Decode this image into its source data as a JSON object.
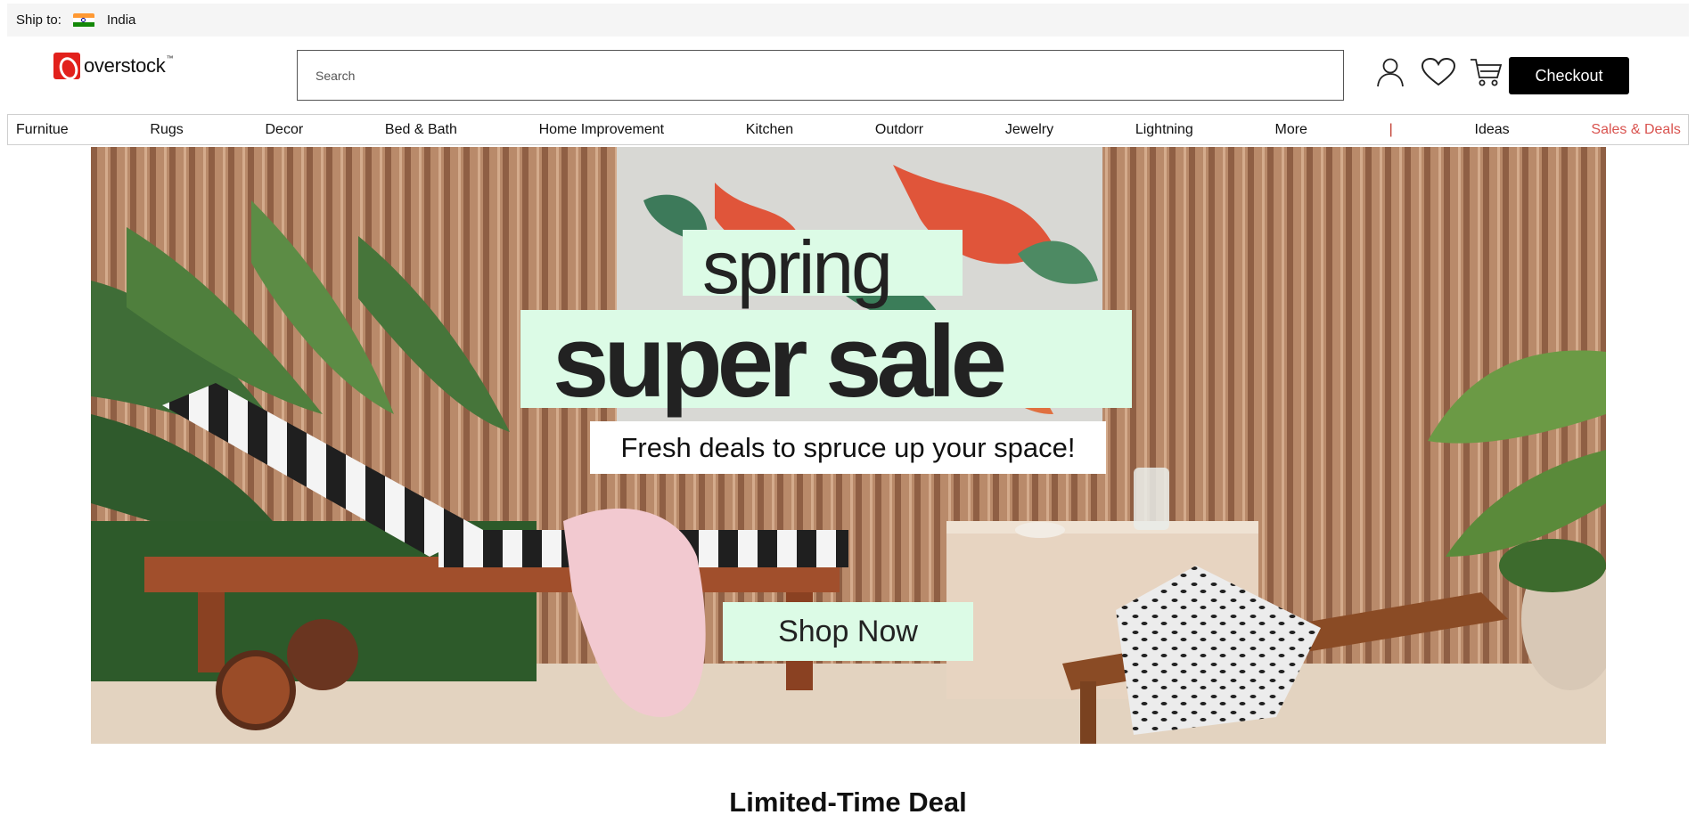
{
  "topbar": {
    "ship_label": "Ship to:",
    "country": "India",
    "flag_icon": "india-flag-icon"
  },
  "header": {
    "logo_text": "overstock",
    "logo_tm": "™",
    "search_placeholder": "Search",
    "checkout_label": "Checkout",
    "icons": [
      "account-icon",
      "heart-icon",
      "cart-icon"
    ]
  },
  "nav": {
    "items": [
      "Furnitue",
      "Rugs",
      "Decor",
      "Bed & Bath",
      "Home Improvement",
      "Kitchen",
      "Outdorr",
      "Jewelry",
      "Lightning",
      "More"
    ],
    "separator": "|",
    "ideas": "Ideas",
    "deals": "Sales & Deals",
    "deals_color": "#d9534f"
  },
  "hero": {
    "line1": "spring",
    "line2": "super sale",
    "tagline": "Fresh deals to spruce up your space!",
    "cta": "Shop Now",
    "badge_color": "#dcfbe6"
  },
  "section": {
    "title": "Limited-Time Deal"
  }
}
